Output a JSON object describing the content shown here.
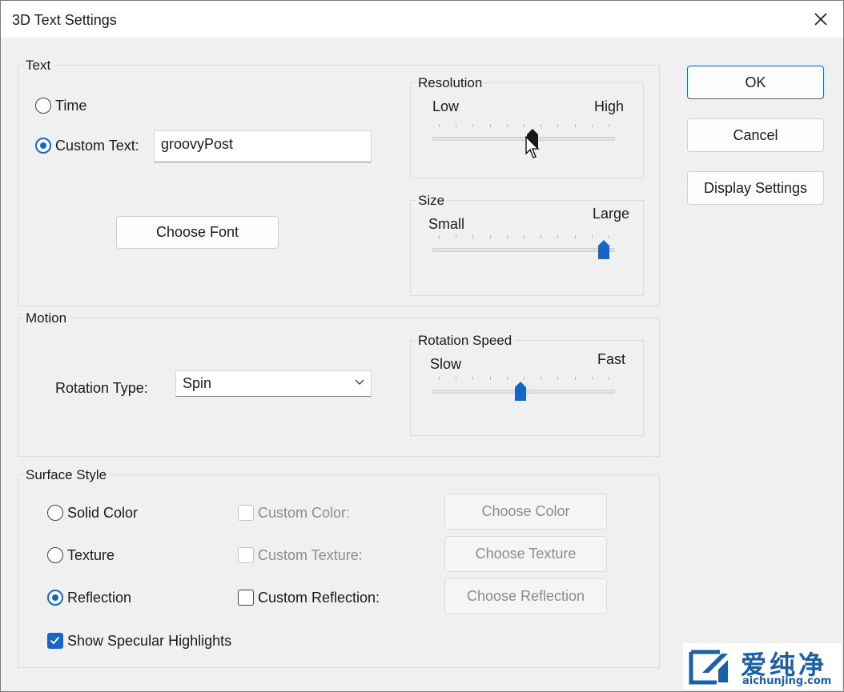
{
  "window": {
    "title": "3D Text Settings"
  },
  "text_group": {
    "label": "Text",
    "time_label": "Time",
    "custom_text_label": "Custom Text:",
    "custom_text_value": "groovyPost",
    "choose_font": "Choose Font",
    "selected": "custom_text"
  },
  "resolution": {
    "label": "Resolution",
    "low": "Low",
    "high": "High",
    "level": 0.55
  },
  "size": {
    "label": "Size",
    "small": "Small",
    "large": "Large",
    "level": 0.97
  },
  "motion_group": {
    "label": "Motion",
    "rotation_type_label": "Rotation Type:",
    "rotation_type_value": "Spin"
  },
  "rotation_speed": {
    "label": "Rotation Speed",
    "slow": "Slow",
    "fast": "Fast",
    "level": 0.48
  },
  "surface_group": {
    "label": "Surface Style",
    "solid_color": "Solid Color",
    "texture": "Texture",
    "reflection": "Reflection",
    "custom_color": "Custom Color:",
    "custom_texture": "Custom Texture:",
    "custom_reflection": "Custom Reflection:",
    "choose_color": "Choose Color",
    "choose_texture": "Choose Texture",
    "choose_reflection": "Choose Reflection",
    "show_specular": "Show Specular Highlights",
    "selected": "reflection",
    "specular_checked": true
  },
  "buttons": {
    "ok": "OK",
    "cancel": "Cancel",
    "display_settings": "Display Settings"
  },
  "watermark": {
    "brand": "爱纯净",
    "url": "aichunjing.com"
  },
  "colors": {
    "accent": "#1666c7",
    "thumb_active": "#1a1a1a",
    "background": "#f0f0f0"
  }
}
